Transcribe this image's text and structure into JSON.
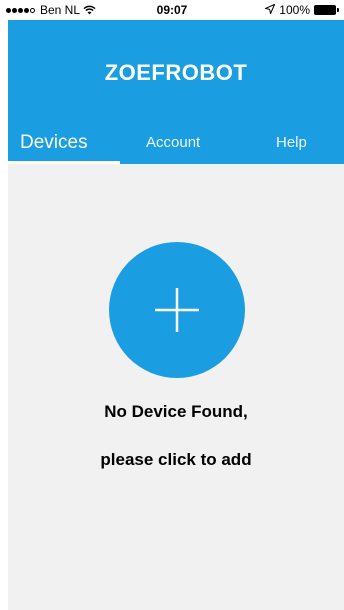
{
  "status_bar": {
    "carrier": "Ben NL",
    "time": "09:07",
    "battery": "100%",
    "signal_bars_filled": 4,
    "signal_bars_total": 5
  },
  "header": {
    "title": "ZOEFROBOT",
    "background_color": "#1a9de1"
  },
  "tabs": [
    {
      "label": "Devices",
      "selected": true
    },
    {
      "label": "Account",
      "selected": false
    },
    {
      "label": "Help",
      "selected": false
    }
  ],
  "main": {
    "add_button_icon": "plus-icon",
    "message_line1": "No Device Found,",
    "message_line2": "please click to add",
    "background_color": "#f1f1f1"
  }
}
